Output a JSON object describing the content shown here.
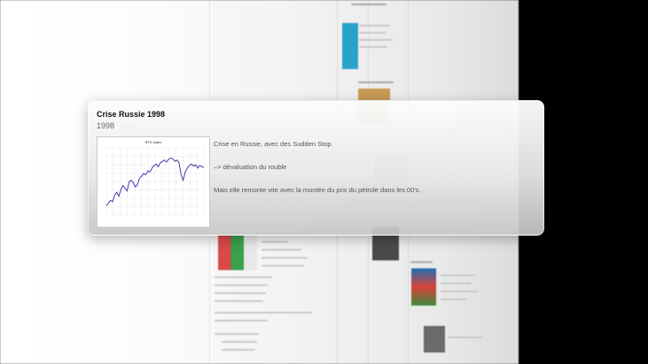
{
  "card": {
    "title": "Crise Russie 1998",
    "year": "1998",
    "year_ghost": "········",
    "paragraphs": [
      "Crise en Russie, avec des Sudden Stop.",
      "–> dévaluation du rouble",
      "Mais elle remonte vite avec la montée du prix du pétrole dans les 00's."
    ]
  },
  "chart_data": {
    "type": "line",
    "title": "RTS Index",
    "series": [
      {
        "values": [
          14,
          18,
          22,
          20,
          30,
          34,
          28,
          38,
          44,
          40,
          36,
          50,
          52,
          48,
          42,
          46,
          55,
          58,
          62,
          60,
          66,
          64,
          70,
          74,
          76,
          72,
          78,
          80,
          82,
          79,
          83,
          85,
          84,
          80,
          82,
          78,
          60,
          52,
          64,
          70,
          74,
          76,
          73,
          75,
          70,
          74,
          72,
          71
        ]
      }
    ],
    "ylim": [
      0,
      100
    ],
    "colors": {
      "line": "#2a2aa8",
      "grid": "#e2e2e2"
    }
  }
}
